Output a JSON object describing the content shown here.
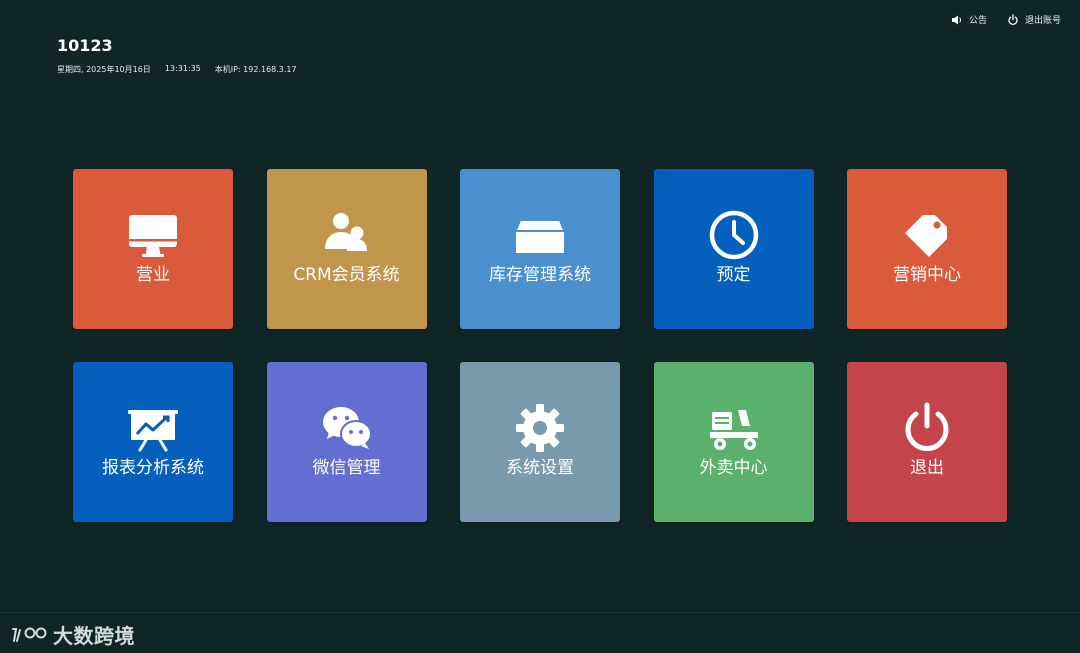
{
  "topbar": {
    "announcement_label": "公告",
    "logout_account_label": "退出账号"
  },
  "station": {
    "id": "10123",
    "weekday": "星期四, 2025年10月16日",
    "time": "13:31:35",
    "ip_label": "本机IP: 192.168.3.17"
  },
  "tiles": [
    {
      "label": "营业",
      "icon": "monitor-icon",
      "color": "#d95b3b"
    },
    {
      "label": "CRM会员系统",
      "icon": "users-icon",
      "color": "#bf964b"
    },
    {
      "label": "库存管理系统",
      "icon": "inventory-box-icon",
      "color": "#4a8fce"
    },
    {
      "label": "预定",
      "icon": "clock-icon",
      "color": "#0560bd"
    },
    {
      "label": "营销中心",
      "icon": "tag-icon",
      "color": "#d95b3b"
    },
    {
      "label": "报表分析系统",
      "icon": "chart-board-icon",
      "color": "#0560bd"
    },
    {
      "label": "微信管理",
      "icon": "wechat-icon",
      "color": "#626fd1"
    },
    {
      "label": "系统设置",
      "icon": "gear-icon",
      "color": "#7a9bad"
    },
    {
      "label": "外卖中心",
      "icon": "delivery-scooter-icon",
      "color": "#5bb16c"
    },
    {
      "label": "退出",
      "icon": "power-icon",
      "color": "#c3454b"
    }
  ],
  "footer": {
    "brand_text": "大数跨境"
  }
}
